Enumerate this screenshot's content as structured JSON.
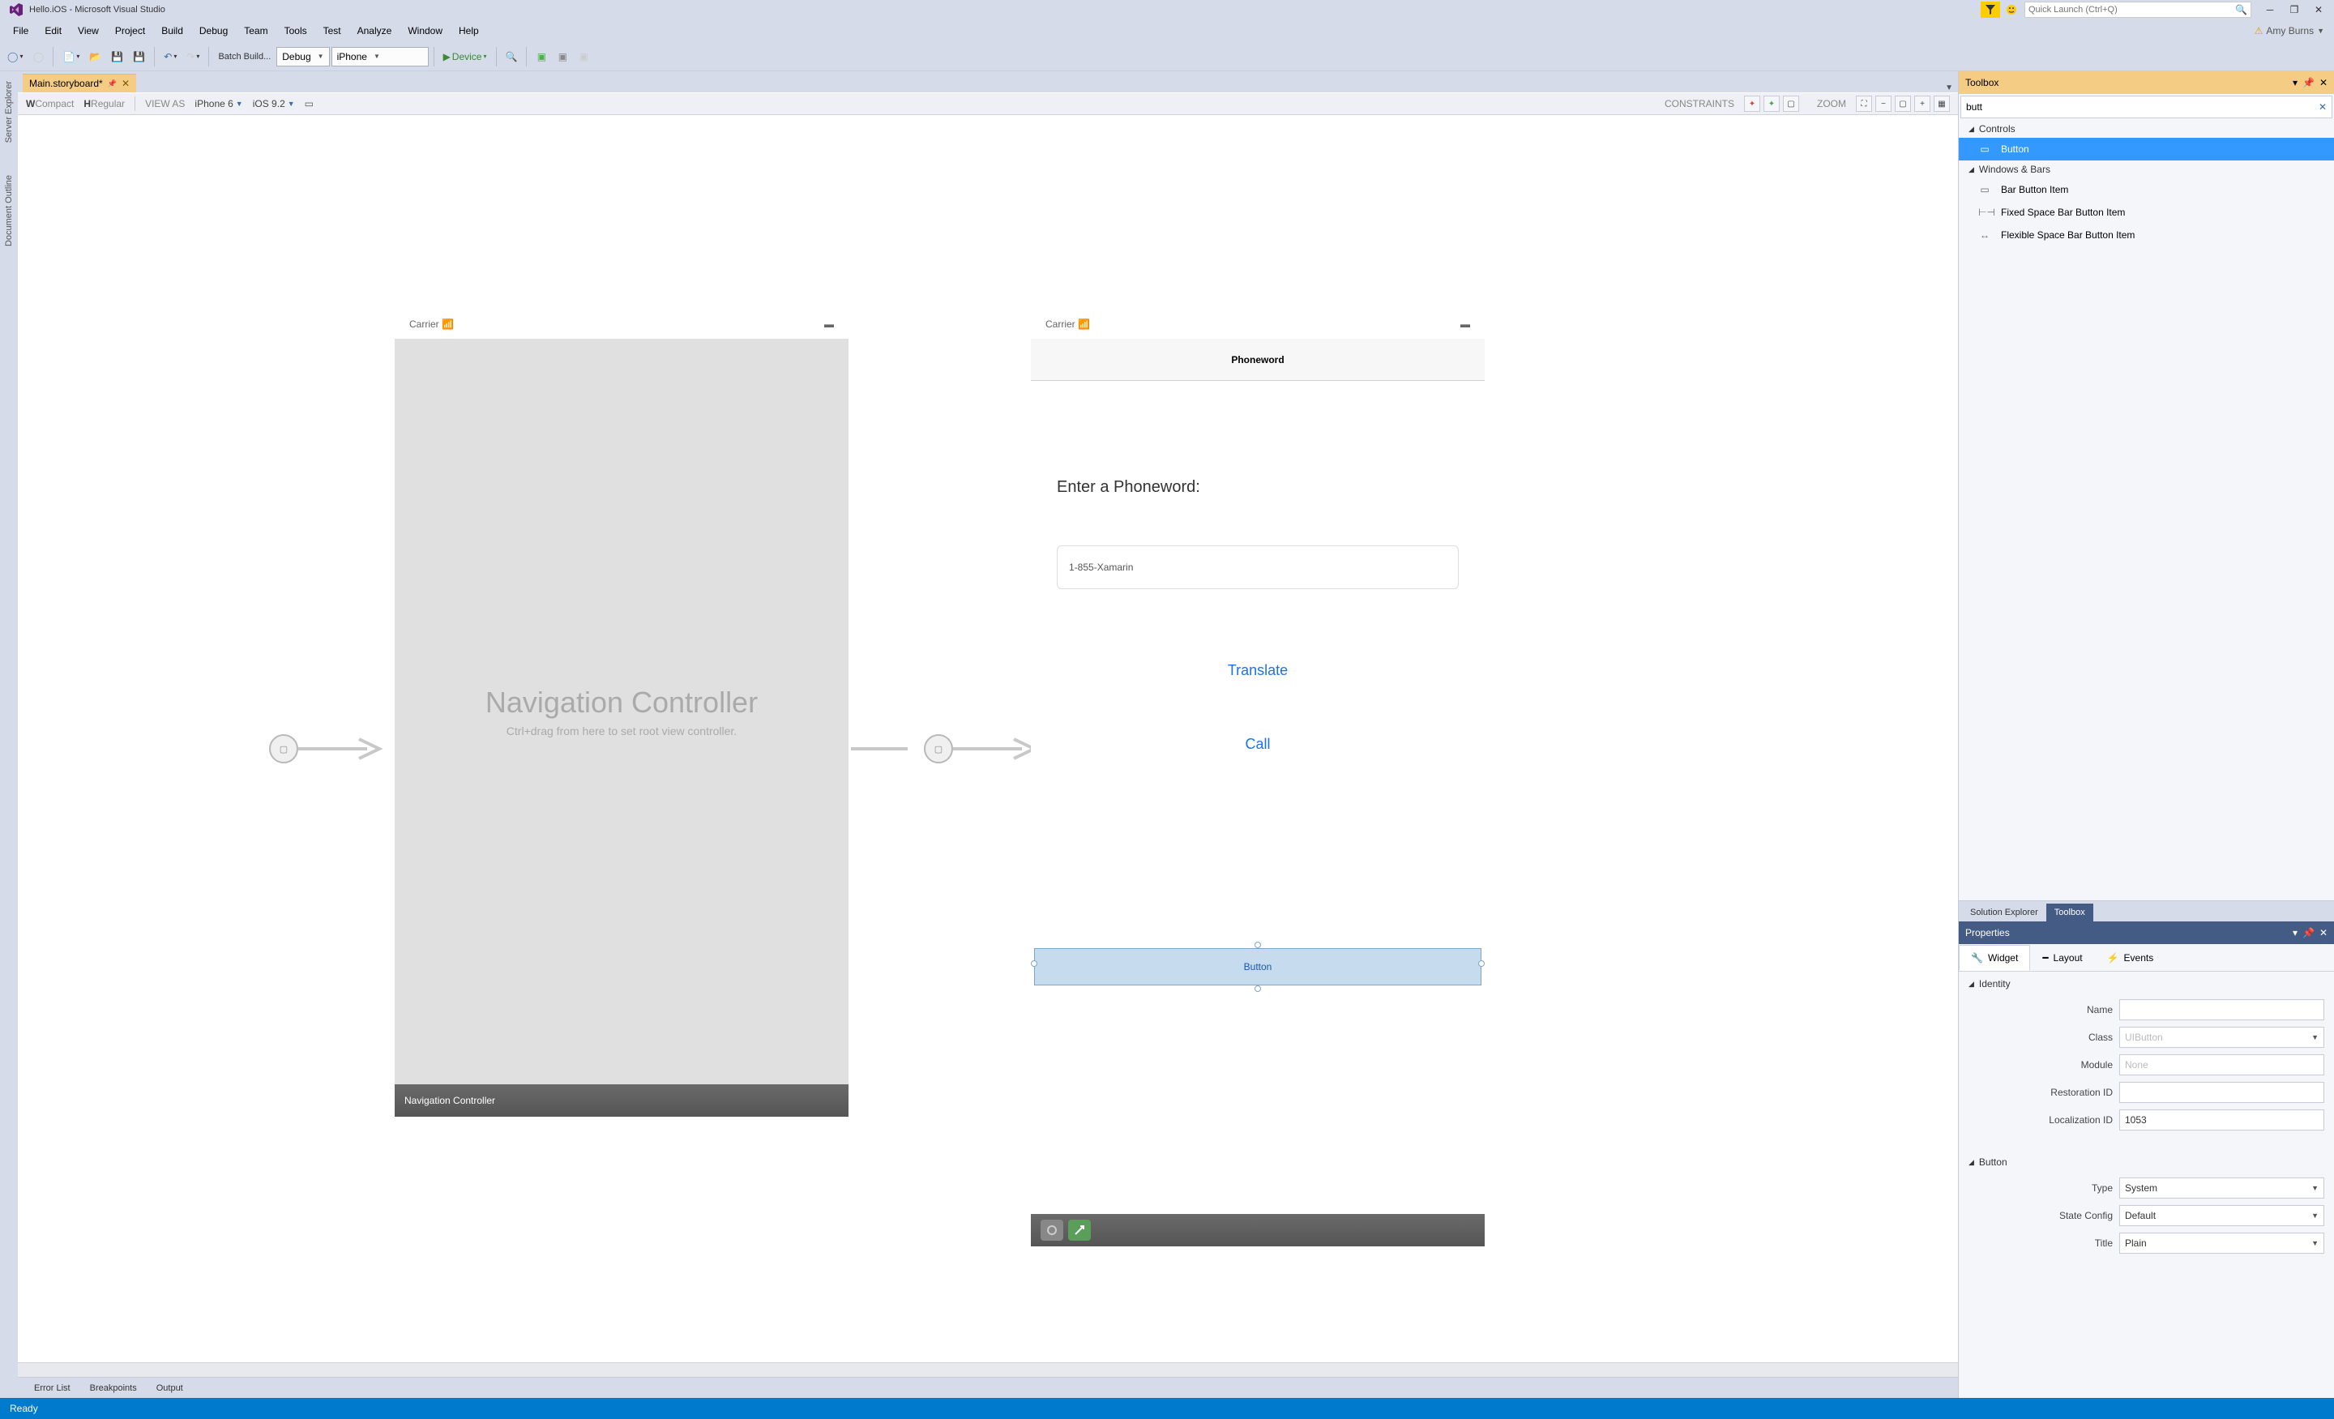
{
  "window": {
    "title": "Hello.iOS - Microsoft Visual Studio"
  },
  "quick_launch": {
    "placeholder": "Quick Launch (Ctrl+Q)"
  },
  "user": {
    "name": "Amy Burns"
  },
  "menu": [
    "File",
    "Edit",
    "View",
    "Project",
    "Build",
    "Debug",
    "Team",
    "Tools",
    "Test",
    "Analyze",
    "Window",
    "Help"
  ],
  "toolbar": {
    "batch_build": "Batch Build...",
    "config": "Debug",
    "platform": "iPhone",
    "device": "Device"
  },
  "doc_tab": {
    "name": "Main.storyboard*"
  },
  "designer_bar": {
    "w": "W",
    "wval": "Compact",
    "h": "H",
    "hval": "Regular",
    "view_as": "VIEW AS",
    "device": "iPhone 6",
    "ios": "iOS 9.2",
    "constraints": "CONSTRAINTS",
    "zoom": "ZOOM"
  },
  "scene1": {
    "carrier": "Carrier",
    "title": "Navigation Controller",
    "hint": "Ctrl+drag from here to set root view controller.",
    "footer": "Navigation Controller"
  },
  "scene2": {
    "carrier": "Carrier",
    "nav_title": "Phoneword",
    "label": "Enter a Phoneword:",
    "textfield": "1-855-Xamarin",
    "translate": "Translate",
    "call": "Call",
    "button": "Button"
  },
  "toolbox": {
    "title": "Toolbox",
    "search": "butt",
    "groups": {
      "controls": "Controls",
      "windows": "Windows & Bars"
    },
    "items": {
      "button": "Button",
      "bar_button": "Bar Button Item",
      "fixed_space": "Fixed Space Bar Button Item",
      "flex_space": "Flexible Space Bar Button Item"
    }
  },
  "panel_tabs": {
    "solution": "Solution Explorer",
    "toolbox": "Toolbox"
  },
  "properties": {
    "title": "Properties",
    "tabs": {
      "widget": "Widget",
      "layout": "Layout",
      "events": "Events"
    },
    "identity": "Identity",
    "name_lbl": "Name",
    "name_val": "",
    "class_lbl": "Class",
    "class_val": "UIButton",
    "module_lbl": "Module",
    "module_val": "None",
    "restoration_lbl": "Restoration ID",
    "restoration_val": "",
    "localization_lbl": "Localization ID",
    "localization_val": "1053",
    "button_section": "Button",
    "type_lbl": "Type",
    "type_val": "System",
    "state_lbl": "State Config",
    "state_val": "Default",
    "title_lbl": "Title",
    "title_val": "Plain"
  },
  "bottom_tabs": [
    "Error List",
    "Breakpoints",
    "Output"
  ],
  "status": {
    "ready": "Ready"
  },
  "side_tabs": [
    "Server Explorer",
    "Document Outline"
  ]
}
